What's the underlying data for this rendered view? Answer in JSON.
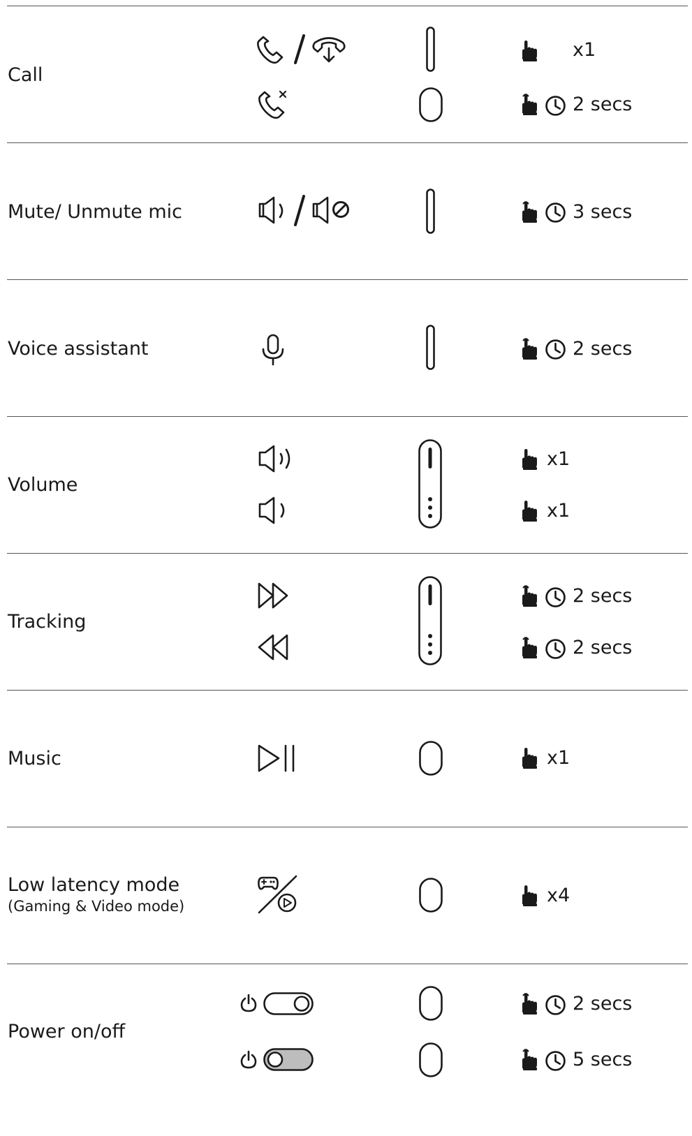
{
  "rows": [
    {
      "label": "Call",
      "actions": [
        {
          "value": "x1"
        },
        {
          "value": "2 secs"
        }
      ]
    },
    {
      "label": "Mute/ Unmute mic",
      "actions": [
        {
          "value": "3 secs"
        }
      ]
    },
    {
      "label": "Voice assistant",
      "actions": [
        {
          "value": "2 secs"
        }
      ]
    },
    {
      "label": "Volume",
      "actions": [
        {
          "value": "x1"
        },
        {
          "value": "x1"
        }
      ]
    },
    {
      "label": "Tracking",
      "actions": [
        {
          "value": "2 secs"
        },
        {
          "value": "2 secs"
        }
      ]
    },
    {
      "label": "Music",
      "actions": [
        {
          "value": "x1"
        }
      ]
    },
    {
      "label": "Low latency mode",
      "sublabel": "(Gaming & Video mode)",
      "actions": [
        {
          "value": "x4"
        }
      ]
    },
    {
      "label": "Power on/off",
      "actions": [
        {
          "value": "2 secs"
        },
        {
          "value": "5 secs"
        }
      ]
    }
  ],
  "icons": {
    "call": [
      "phone-icon",
      "phone-hangup-icon",
      "phone-reject-icon"
    ],
    "mic": [
      "speaker-icon",
      "speaker-muted-icon"
    ],
    "voice": [
      "microphone-icon"
    ],
    "volume": [
      "volume-up-icon",
      "volume-down-icon"
    ],
    "tracking": [
      "fast-forward-icon",
      "rewind-icon"
    ],
    "music": [
      "play-pause-icon"
    ],
    "latency": [
      "gamepad-icon",
      "video-play-icon"
    ],
    "power": [
      "power-icon",
      "toggle-on-icon",
      "toggle-off-icon"
    ],
    "gestures": [
      "tap-icon",
      "press-hold-icon",
      "clock-icon",
      "touch-slider-icon",
      "button-icon"
    ]
  },
  "colors": {
    "ink": "#1a1a1a",
    "divider": "#555555",
    "toggle_off_fill": "#bdbdbd"
  }
}
